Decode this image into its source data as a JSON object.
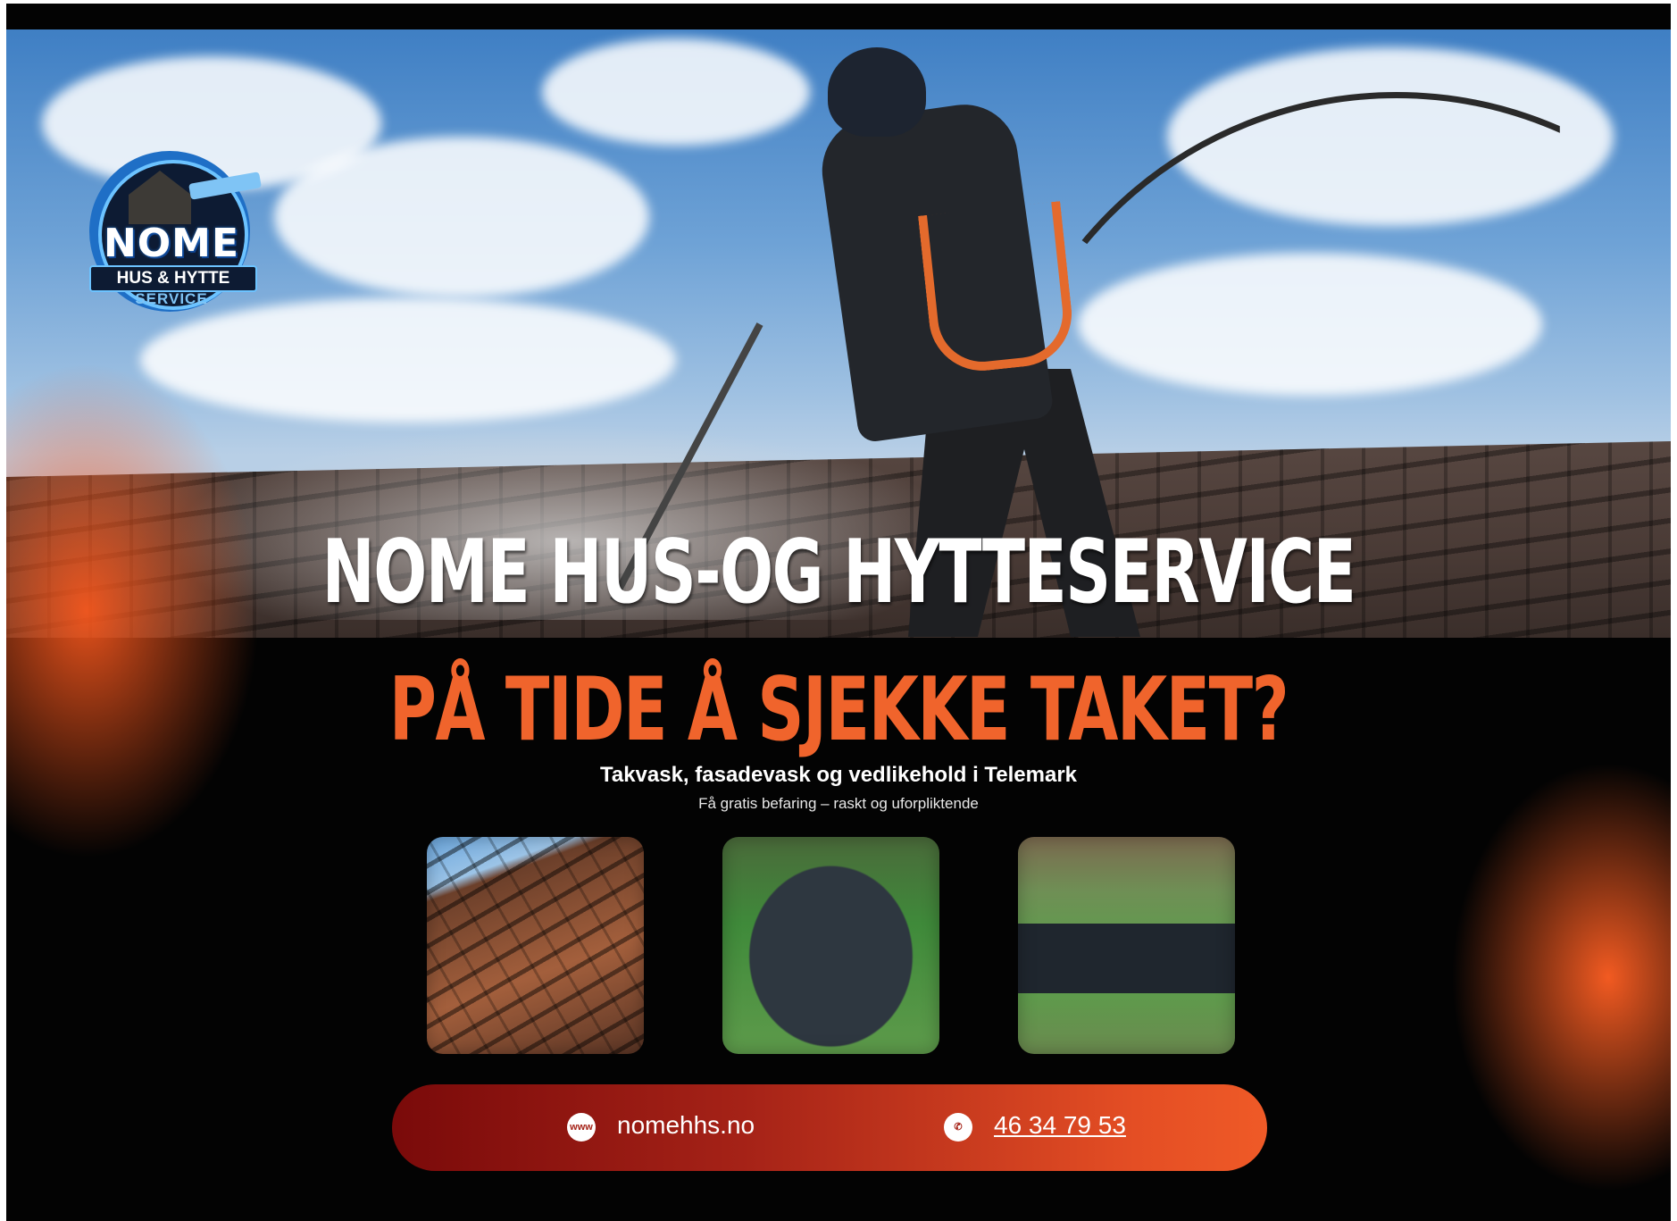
{
  "logo": {
    "name": "NOME",
    "line2": "HUS & HYTTE",
    "line3": "SERVICE"
  },
  "headline": "NOME HUS-OG HYTTESERVICE",
  "subheadline": "PÅ TIDE Å SJEKKE TAKET?",
  "tagline": "Takvask, fasadevask og vedlikehold i Telemark",
  "smalltext": "Få gratis befaring – raskt og uforpliktende",
  "gallery": [
    {
      "icon": "roof-tiles-photo"
    },
    {
      "icon": "house-aerial-photo"
    },
    {
      "icon": "roof-aerial-photo"
    }
  ],
  "contact": {
    "website": "nomehhs.no",
    "web_icon_text": "www",
    "phone": "46 34 79 53",
    "phone_icon_text": "✆"
  },
  "colors": {
    "accent_orange": "#f0642c",
    "background": "#030303",
    "bar_start": "#7a0a0a",
    "bar_end": "#ef5a27"
  }
}
